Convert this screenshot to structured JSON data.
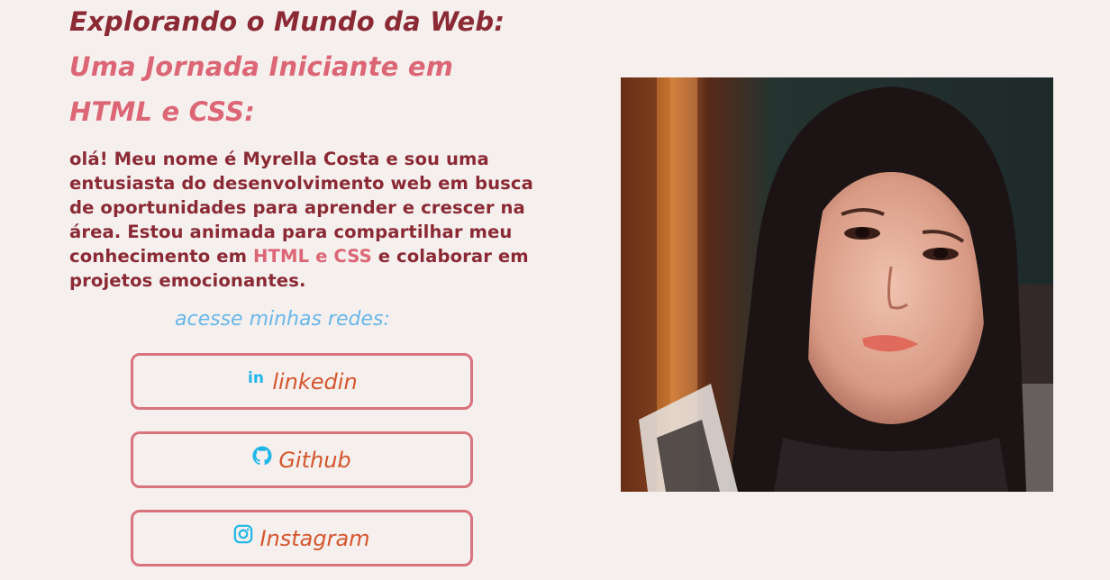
{
  "hero": {
    "title_line1": "Explorando o Mundo da Web:",
    "title_line2": "Uma Jornada Iniciante em",
    "title_line3": "HTML e CSS:"
  },
  "intro": {
    "text_before": "olá! Meu nome é Myrella Costa e sou uma entusiasta do desenvolvimento web em busca de oportunidades para aprender e crescer na área. Estou animada para compartilhar meu conhecimento em ",
    "highlight": "HTML e CSS",
    "text_after": " e colaborar em projetos emocionantes."
  },
  "socials": {
    "heading": "acesse minhas redes:",
    "items": [
      {
        "label": "linkedin",
        "icon": "linkedin-icon"
      },
      {
        "label": "Github",
        "icon": "github-icon"
      },
      {
        "label": "Instagram",
        "icon": "instagram-icon"
      }
    ]
  },
  "colors": {
    "background": "#f5f0ee",
    "title_dark": "#8b2a35",
    "title_pink": "#dc6675",
    "heading_blue": "#69b7e8",
    "button_border": "#d9737e",
    "button_text": "#d4552c",
    "icon_blue": "#1fb6e8"
  },
  "profile_photo": {
    "description_icon": "profile-photo"
  }
}
